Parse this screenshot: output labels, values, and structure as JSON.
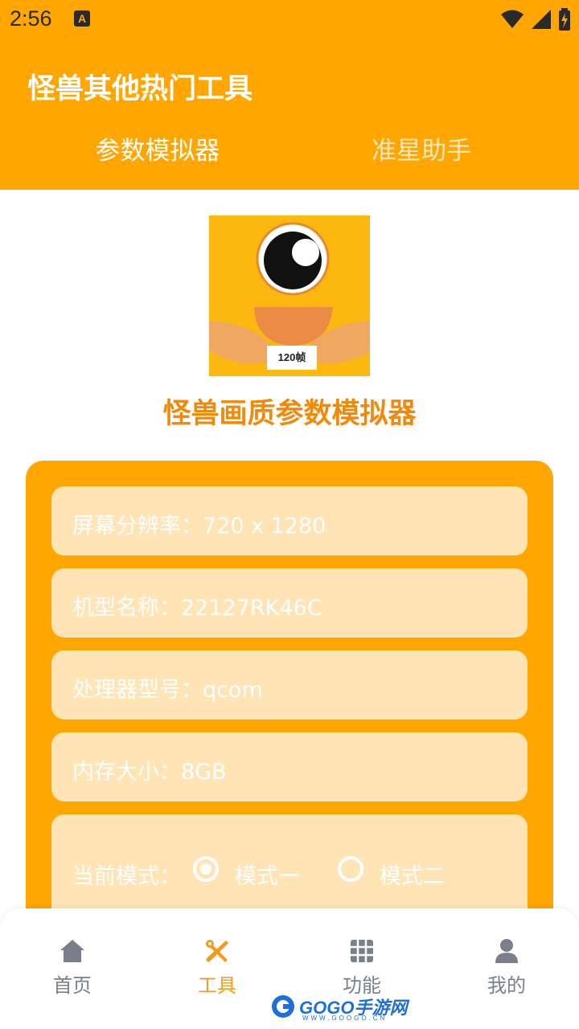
{
  "status_bar": {
    "time": "2:56",
    "notification_glyph": "A",
    "icons": [
      "wifi-icon",
      "signal-icon",
      "battery-charging-icon"
    ]
  },
  "header": {
    "title": "怪兽其他热门工具",
    "tabs": [
      {
        "label": "参数模拟器",
        "active": true
      },
      {
        "label": "准星助手",
        "active": false
      }
    ]
  },
  "logo": {
    "badge": "120帧",
    "icon": "one-eyed-monster-logo"
  },
  "app_name": "怪兽画质参数模拟器",
  "info": {
    "resolution": "屏幕分辨率：720 x 1280",
    "model": "机型名称：22127RK46C",
    "processor": "处理器型号：qcom",
    "memory": "内存大小：8GB"
  },
  "mode": {
    "label": "当前模式：",
    "options": [
      {
        "label": "模式一",
        "selected": true
      },
      {
        "label": "模式二",
        "selected": false
      }
    ]
  },
  "bottom_nav": {
    "items": [
      {
        "label": "首页",
        "icon": "home-icon",
        "active": false
      },
      {
        "label": "工具",
        "icon": "tools-icon",
        "active": true
      },
      {
        "label": "功能",
        "icon": "grid-icon",
        "active": false
      },
      {
        "label": "我的",
        "icon": "profile-icon",
        "active": false
      }
    ]
  },
  "watermark": {
    "text": "GOGO手游网",
    "subtext": "WWW.GOOGO.CN"
  },
  "colors": {
    "primary": "#FFA600",
    "row_background": "#FFE4B5",
    "title_orange": "#F08A0A",
    "nav_active": "#F39A23",
    "nav_inactive": "#7B7F8A"
  }
}
